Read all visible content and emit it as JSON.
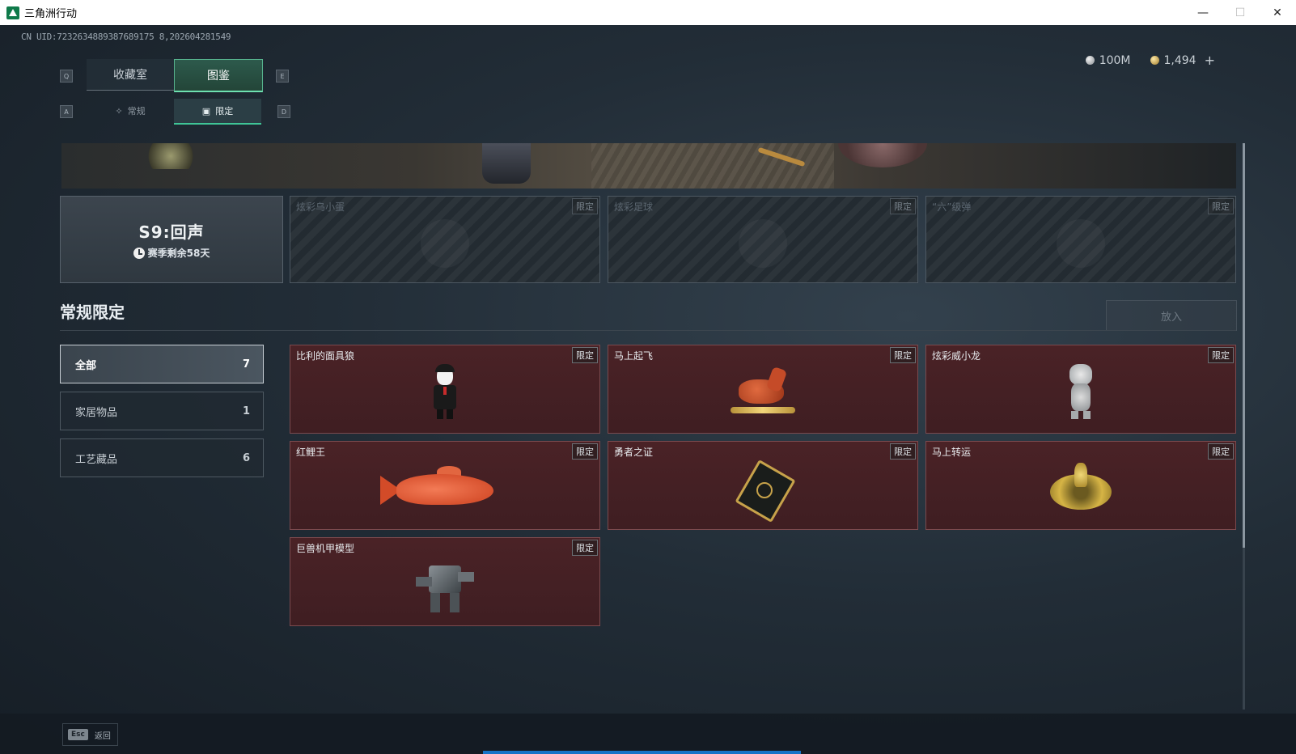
{
  "window": {
    "title": "三角洲行动",
    "minimize": "—",
    "maximize": "☐",
    "close": "✕"
  },
  "uid": "CN UID:7232634889387689175 8,202604281549",
  "currency": [
    {
      "icon": "silver-coin-icon",
      "value": "100M"
    },
    {
      "icon": "gold-coin-icon",
      "value": "1,494"
    }
  ],
  "currency_add": "+",
  "key_hints": {
    "prev_tab": "Q",
    "next_tab": "E",
    "prev_sub": "A",
    "next_sub": "D"
  },
  "tabs": [
    {
      "label": "收藏室",
      "active": false
    },
    {
      "label": "图鉴",
      "active": true
    }
  ],
  "subtabs": [
    {
      "label": "常规",
      "icon": "✧",
      "active": false
    },
    {
      "label": "限定",
      "icon": "▣",
      "active": true
    }
  ],
  "season": {
    "title": "S9:回声",
    "remaining": "赛季剩余58天"
  },
  "season_items": [
    {
      "name": "炫彩乌小蛋",
      "tag": "限定"
    },
    {
      "name": "炫彩足球",
      "tag": "限定"
    },
    {
      "name": "“六”级弹",
      "tag": "限定"
    }
  ],
  "section": {
    "title": "常规限定",
    "put_button": "放入"
  },
  "categories": [
    {
      "label": "全部",
      "count": "7",
      "active": true
    },
    {
      "label": "家居物品",
      "count": "1",
      "active": false
    },
    {
      "label": "工艺藏品",
      "count": "6",
      "active": false
    }
  ],
  "items": [
    {
      "name": "比利的面具狼",
      "tag": "限定"
    },
    {
      "name": "马上起飞",
      "tag": "限定"
    },
    {
      "name": "炫彩威小龙",
      "tag": "限定"
    },
    {
      "name": "红鲤王",
      "tag": "限定"
    },
    {
      "name": "勇者之证",
      "tag": "限定"
    },
    {
      "name": "马上转运",
      "tag": "限定"
    },
    {
      "name": "巨兽机甲模型",
      "tag": "限定"
    }
  ],
  "footer": {
    "esc_key": "Esc",
    "esc_label": "返回"
  },
  "colors": {
    "accent_green": "#3fc496",
    "item_card_bg": "#4a2226",
    "progress_blue": "#1473c7"
  }
}
